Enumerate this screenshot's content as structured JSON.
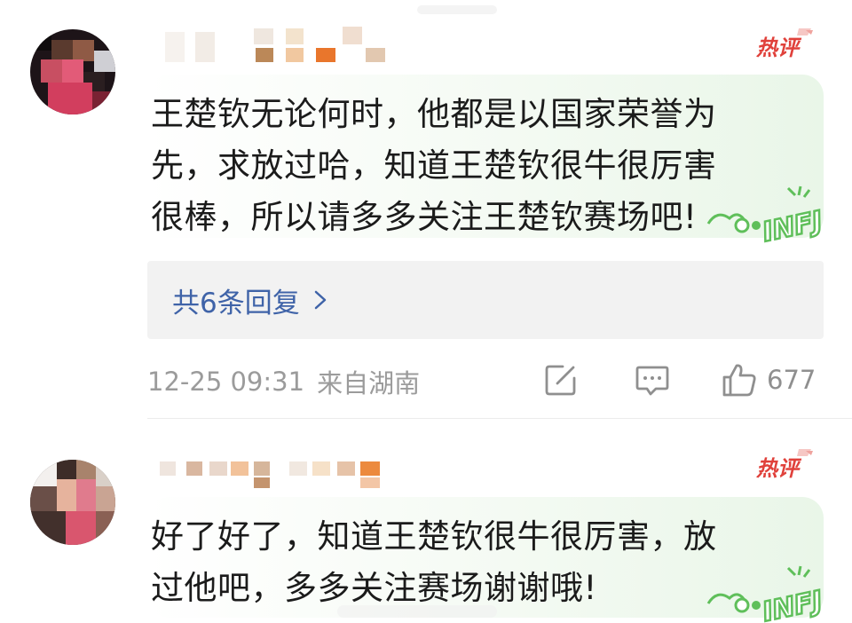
{
  "comments": [
    {
      "text": "王楚钦无论何时，他都是以国家荣誉为先，求放过哈，知道王楚钦很牛很厉害很棒，所以请多多关注王楚钦赛场吧!",
      "badge": "热评",
      "sticker_text": "INFJ",
      "replies_label": "共6条回复",
      "timestamp": "12-25 09:31",
      "location": "来自湖南",
      "like_count": "677"
    },
    {
      "text": "好了好了，知道王楚钦很牛很厉害，放过他吧，多多关注赛场谢谢哦!",
      "badge": "热评",
      "sticker_text": "INFJ"
    }
  ],
  "icons": {
    "share": "share-edit-icon",
    "comment": "comment-icon",
    "like": "thumbs-up-icon",
    "chevron": "chevron-right-icon",
    "badge": "hot-comment-badge"
  },
  "colors": {
    "reply_link": "#3f63a8",
    "meta_text": "#9b9b9b",
    "badge_red": "#e0413b",
    "bubble_green": "#e9f6e8",
    "sticker_green": "#5fbf5a"
  }
}
